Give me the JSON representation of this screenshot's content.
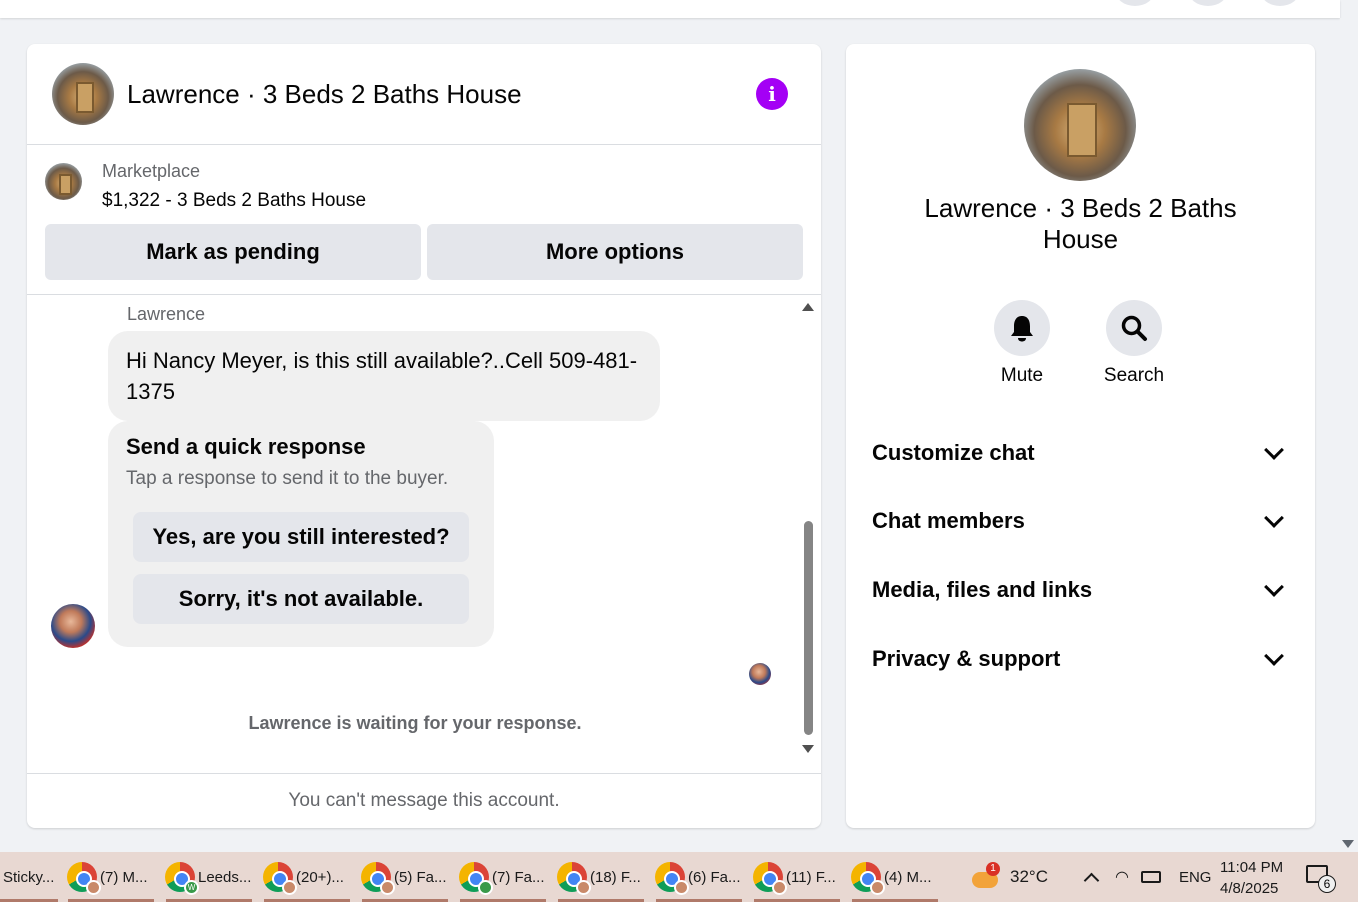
{
  "chat": {
    "title": "Lawrence · 3 Beds 2 Baths House",
    "marketplace_label": "Marketplace",
    "listing": "$1,322 - 3 Beds 2 Baths House",
    "mark_pending_label": "Mark as pending",
    "more_options_label": "More options",
    "sender_name": "Lawrence",
    "message_text": "Hi Nancy Meyer, is this still available?..Cell 509-481-1375",
    "quick_response": {
      "title": "Send a quick response",
      "subtitle": "Tap a response to send it to the buyer.",
      "option1": "Yes, are you still interested?",
      "option2": "Sorry, it's not available."
    },
    "waiting_text": "Lawrence is waiting for your response.",
    "composer_text": "You can't message this account."
  },
  "info_panel": {
    "title": "Lawrence · 3 Beds 2 Baths House",
    "mute_label": "Mute",
    "search_label": "Search",
    "sections": [
      "Customize chat",
      "Chat members",
      "Media, files and links",
      "Privacy & support"
    ]
  },
  "taskbar": {
    "items": [
      "Sticky...",
      "(7) M...",
      "Leeds...",
      "(20+)...",
      "(5) Fa...",
      "(7) Fa...",
      "(18) F...",
      "(6) Fa...",
      "(11) F...",
      "(4) M..."
    ],
    "weather_badge": "1",
    "temperature": "32°C",
    "language": "ENG",
    "time": "11:04 PM",
    "date": "4/8/2025",
    "notification_count": "6"
  },
  "colors": {
    "accent": "#a400f5",
    "button_bg": "#e4e6eb",
    "bubble_bg": "#f0f0f0",
    "secondary_text": "#65676b"
  }
}
